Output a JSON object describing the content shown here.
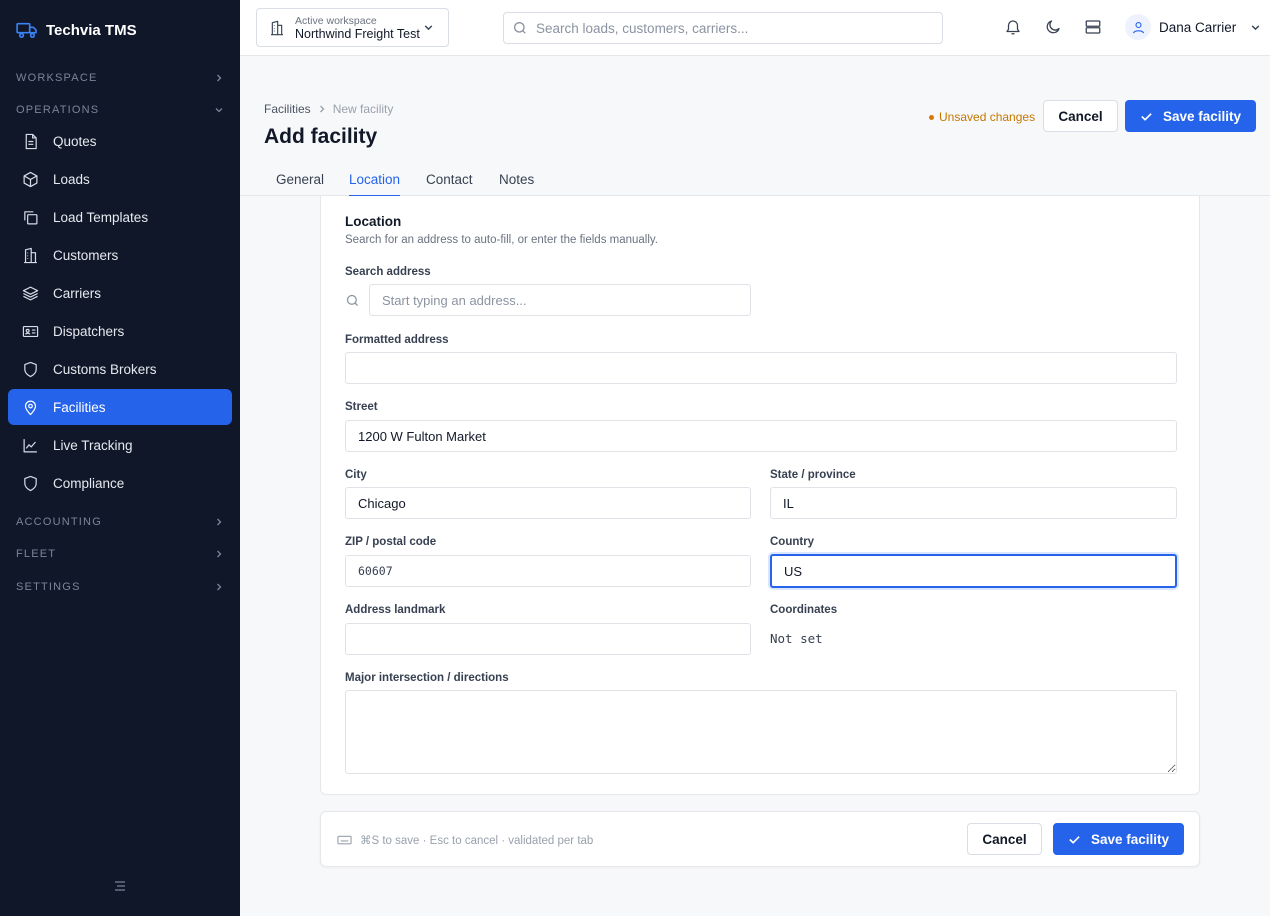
{
  "app": {
    "name": "Techvia TMS"
  },
  "sidebar": {
    "sections": {
      "workspace": "WORKSPACE",
      "operations": "OPERATIONS",
      "accounting": "ACCOUNTING",
      "fleet": "FLEET",
      "settings": "SETTINGS"
    },
    "items": [
      {
        "label": "Quotes",
        "icon": "document-icon"
      },
      {
        "label": "Loads",
        "icon": "box-icon"
      },
      {
        "label": "Load Templates",
        "icon": "copy-icon"
      },
      {
        "label": "Customers",
        "icon": "building-icon"
      },
      {
        "label": "Carriers",
        "icon": "layers-icon"
      },
      {
        "label": "Dispatchers",
        "icon": "id-card-icon"
      },
      {
        "label": "Customs Brokers",
        "icon": "shield-icon"
      },
      {
        "label": "Facilities",
        "icon": "map-pin-icon",
        "active": true
      },
      {
        "label": "Live Tracking",
        "icon": "line-chart-icon"
      },
      {
        "label": "Compliance",
        "icon": "shield-icon"
      }
    ],
    "active_color": "#2563eb"
  },
  "topbar": {
    "workspace_label": "Active workspace",
    "workspace_name": "Northwind Freight Test",
    "search_placeholder": "Search loads, customers, carriers...",
    "user_name": "Dana Carrier"
  },
  "page": {
    "breadcrumb": [
      "Facilities",
      "New facility"
    ],
    "title": "Add facility",
    "unsaved": "Unsaved changes",
    "cancel": "Cancel",
    "save": "Save facility"
  },
  "tabs": [
    "General",
    "Location",
    "Contact",
    "Notes"
  ],
  "active_tab": "Location",
  "form": {
    "title": "Location",
    "subtitle": "Search for an address to auto-fill, or enter the fields manually.",
    "search_label": "Search address",
    "search_placeholder": "Start typing an address...",
    "formatted_label": "Formatted address",
    "formatted_value": "",
    "street_label": "Street",
    "street_value": "1200 W Fulton Market",
    "city_label": "City",
    "city_value": "Chicago",
    "state_label": "State / province",
    "state_value": "IL",
    "zip_label": "ZIP / postal code",
    "zip_value": "60607",
    "country_label": "Country",
    "country_value": "US",
    "landmark_label": "Address landmark",
    "landmark_value": "",
    "coords_label": "Coordinates",
    "coords_value": "Not set",
    "directions_label": "Major intersection / directions",
    "directions_value": ""
  },
  "footer": {
    "hint": "⌘S to save · Esc to cancel · validated per tab",
    "cancel": "Cancel",
    "save": "Save facility"
  }
}
